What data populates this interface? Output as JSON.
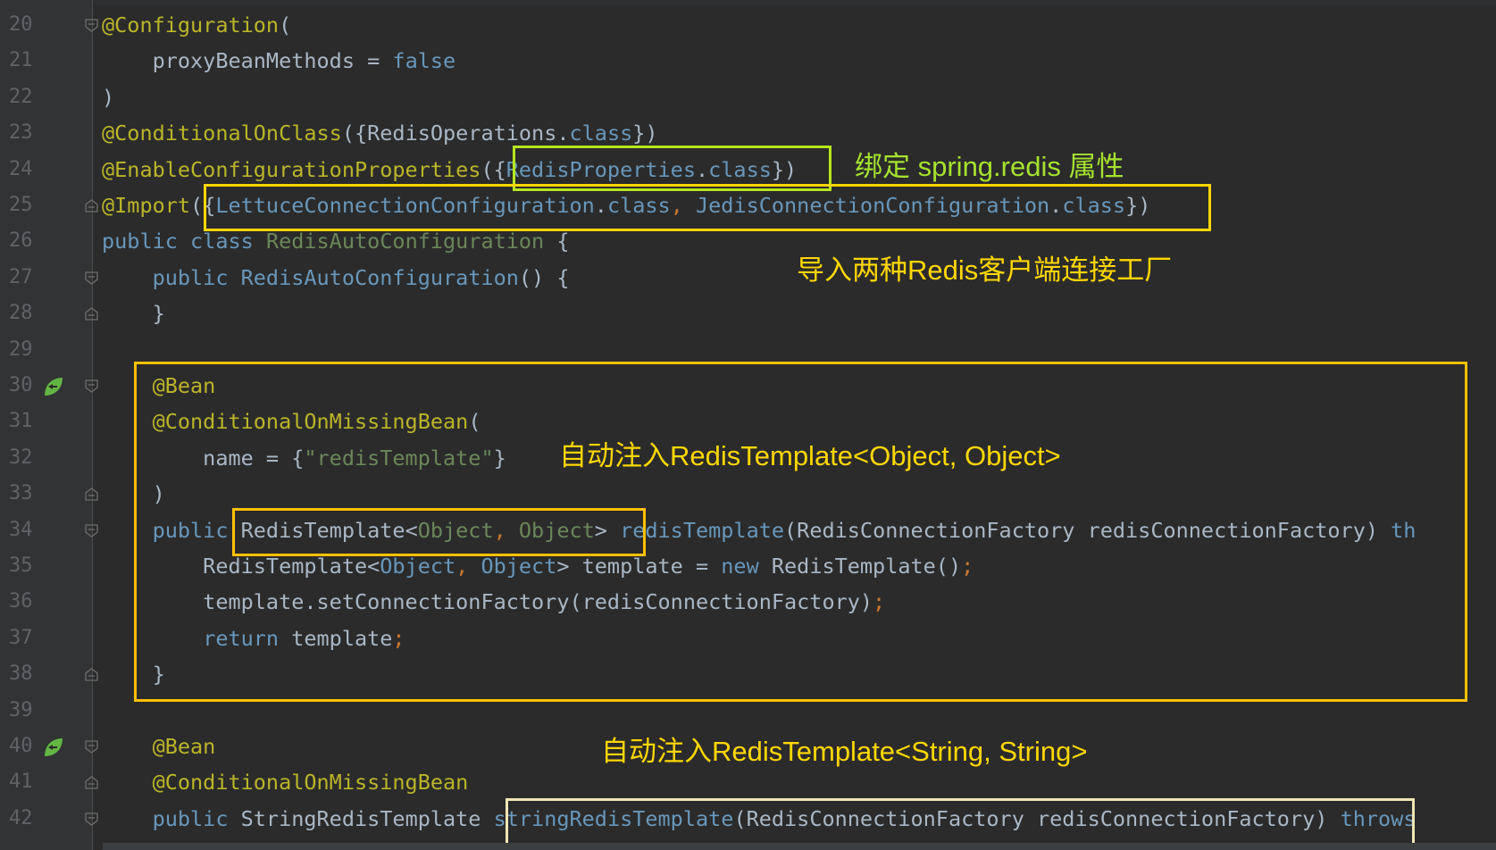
{
  "colors": {
    "background": "#2b2b2b",
    "gutter": "#313335",
    "line_number": "#606366",
    "default_text": "#a9b7c6",
    "annotation": "#bbb529",
    "keyword": "#cc7832",
    "type": "#6897bb",
    "string": "#6a8759",
    "method_decl": "#ffc66d",
    "note_green": "#a6e22e",
    "note_yellow": "#ffd700",
    "box_cream": "#f0e6b4"
  },
  "icons": {
    "fold": "fold-marker-icon",
    "bean": "spring-bean-gutter-icon"
  },
  "lines": [
    {
      "num": "20",
      "segs": [
        {
          "t": "@Configuration",
          "c": "ann"
        },
        {
          "t": "("
        }
      ]
    },
    {
      "num": "21",
      "segs": [
        {
          "t": "    proxyBeanMethods = "
        },
        {
          "t": "false",
          "c": "kwb"
        }
      ]
    },
    {
      "num": "22",
      "segs": [
        {
          "t": ")"
        }
      ]
    },
    {
      "num": "23",
      "segs": [
        {
          "t": "@ConditionalOnClass",
          "c": "ann"
        },
        {
          "t": "({RedisOperations."
        },
        {
          "t": "class",
          "c": "kwb"
        },
        {
          "t": "})"
        }
      ]
    },
    {
      "num": "24",
      "segs": [
        {
          "t": "@EnableConfigurationProperties",
          "c": "ann"
        },
        {
          "t": "({"
        },
        {
          "t": "RedisProperties",
          "c": "cls"
        },
        {
          "t": "."
        },
        {
          "t": "class",
          "c": "kwb"
        },
        {
          "t": "})"
        }
      ]
    },
    {
      "num": "25",
      "segs": [
        {
          "t": "@Import",
          "c": "ann"
        },
        {
          "t": "({"
        },
        {
          "t": "LettuceConnectionConfiguration",
          "c": "cls"
        },
        {
          "t": "."
        },
        {
          "t": "class",
          "c": "kwb"
        },
        {
          "t": ", ",
          "c": "kw"
        },
        {
          "t": "JedisConnectionConfiguration",
          "c": "cls"
        },
        {
          "t": "."
        },
        {
          "t": "class",
          "c": "kwb"
        },
        {
          "t": "})"
        }
      ]
    },
    {
      "num": "26",
      "segs": [
        {
          "t": "public class ",
          "c": "kwb"
        },
        {
          "t": "RedisAutoConfiguration",
          "c": "str"
        },
        {
          "t": " {"
        }
      ]
    },
    {
      "num": "27",
      "segs": [
        {
          "t": "    "
        },
        {
          "t": "public ",
          "c": "kwb"
        },
        {
          "t": "RedisAutoConfiguration",
          "c": "cls"
        },
        {
          "t": "() {"
        }
      ]
    },
    {
      "num": "28",
      "segs": [
        {
          "t": "    }"
        }
      ]
    },
    {
      "num": "29",
      "segs": [
        {
          "t": ""
        }
      ]
    },
    {
      "num": "30",
      "segs": [
        {
          "t": "    "
        },
        {
          "t": "@Bean",
          "c": "ann"
        }
      ]
    },
    {
      "num": "31",
      "segs": [
        {
          "t": "    "
        },
        {
          "t": "@ConditionalOnMissingBean",
          "c": "ann"
        },
        {
          "t": "("
        }
      ]
    },
    {
      "num": "32",
      "segs": [
        {
          "t": "        name = {"
        },
        {
          "t": "\"redisTemplate\"",
          "c": "str"
        },
        {
          "t": "}"
        }
      ]
    },
    {
      "num": "33",
      "segs": [
        {
          "t": "    )"
        }
      ]
    },
    {
      "num": "34",
      "segs": [
        {
          "t": "    "
        },
        {
          "t": "public ",
          "c": "kwb"
        },
        {
          "t": "RedisTemplate<"
        },
        {
          "t": "Object",
          "c": "str"
        },
        {
          "t": ", ",
          "c": "kw"
        },
        {
          "t": "Object",
          "c": "str"
        },
        {
          "t": "> "
        },
        {
          "t": "redisTemplate",
          "c": "cls"
        },
        {
          "t": "(RedisConnectionFactory redisConnectionFactory) "
        },
        {
          "t": "th",
          "c": "kwb"
        }
      ]
    },
    {
      "num": "35",
      "segs": [
        {
          "t": "        RedisTemplate<"
        },
        {
          "t": "Object",
          "c": "cls"
        },
        {
          "t": ", ",
          "c": "kw"
        },
        {
          "t": "Object",
          "c": "cls"
        },
        {
          "t": "> template = "
        },
        {
          "t": "new ",
          "c": "kwb"
        },
        {
          "t": "RedisTemplate()"
        },
        {
          "t": ";",
          "c": "kw"
        }
      ]
    },
    {
      "num": "36",
      "segs": [
        {
          "t": "        template.setConnectionFactory(redisConnectionFactory)"
        },
        {
          "t": ";",
          "c": "kw"
        }
      ]
    },
    {
      "num": "37",
      "segs": [
        {
          "t": "        "
        },
        {
          "t": "return ",
          "c": "kwb"
        },
        {
          "t": "template"
        },
        {
          "t": ";",
          "c": "kw"
        }
      ]
    },
    {
      "num": "38",
      "segs": [
        {
          "t": "    }"
        }
      ]
    },
    {
      "num": "39",
      "segs": [
        {
          "t": ""
        }
      ]
    },
    {
      "num": "40",
      "segs": [
        {
          "t": "    "
        },
        {
          "t": "@Bean",
          "c": "ann"
        }
      ]
    },
    {
      "num": "41",
      "segs": [
        {
          "t": "    "
        },
        {
          "t": "@ConditionalOnMissingBean",
          "c": "ann"
        }
      ]
    },
    {
      "num": "42",
      "segs": [
        {
          "t": "    "
        },
        {
          "t": "public ",
          "c": "kwb"
        },
        {
          "t": "StringRedisTemplate "
        },
        {
          "t": "stringRedisTemplate",
          "c": "cls"
        },
        {
          "t": "(RedisConnectionFactory redisConnectionFactory) "
        },
        {
          "t": "throws",
          "c": "kwb"
        }
      ]
    }
  ],
  "notes": {
    "bind_properties": "绑定 spring.redis 属性",
    "import_factories": "导入两种Redis客户端连接工厂",
    "inject_object": "自动注入RedisTemplate<Object, Object>",
    "inject_string": "自动注入RedisTemplate<String, String>"
  }
}
